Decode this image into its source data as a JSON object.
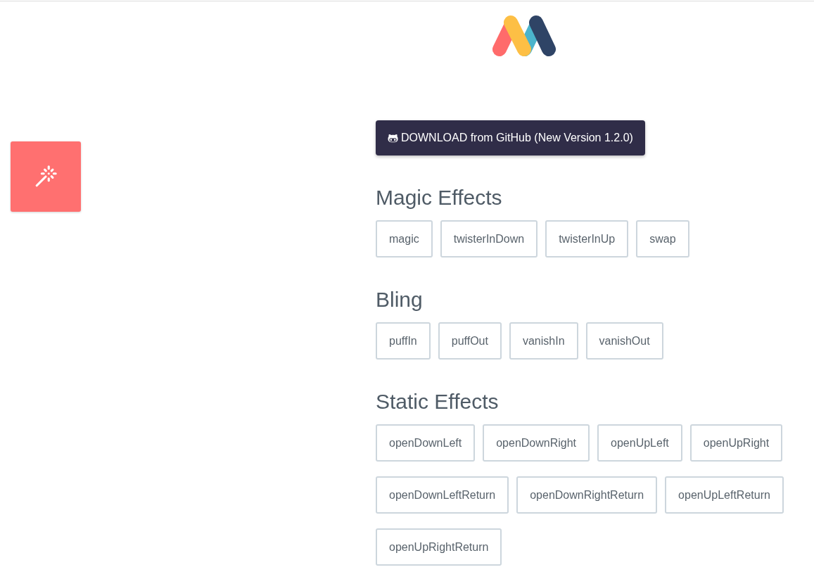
{
  "download_button": {
    "label": "DOWNLOAD from GitHub (New Version 1.2.0)"
  },
  "sections": [
    {
      "title": "Magic Effects",
      "effects": [
        "magic",
        "twisterInDown",
        "twisterInUp",
        "swap"
      ]
    },
    {
      "title": "Bling",
      "effects": [
        "puffIn",
        "puffOut",
        "vanishIn",
        "vanishOut"
      ]
    },
    {
      "title": "Static Effects",
      "effects": [
        "openDownLeft",
        "openDownRight",
        "openUpLeft",
        "openUpRight",
        "openDownLeftReturn",
        "openDownRightReturn",
        "openUpLeftReturn",
        "openUpRightReturn"
      ]
    }
  ]
}
